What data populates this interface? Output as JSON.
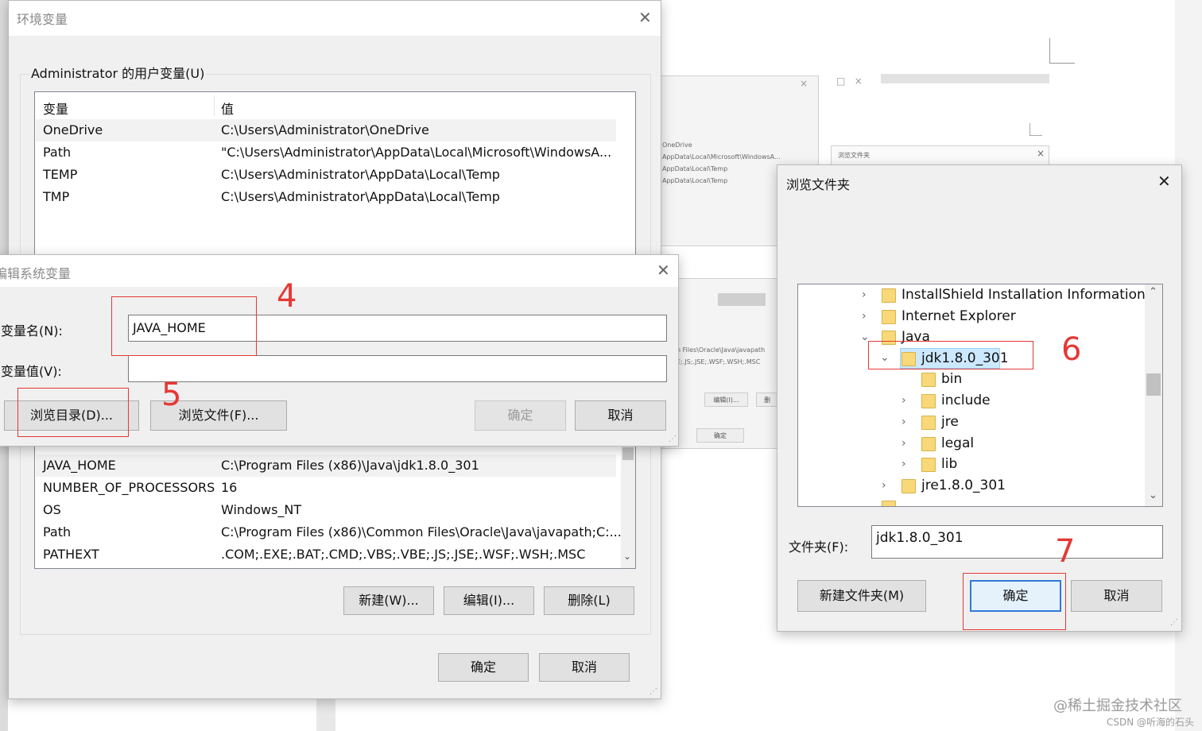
{
  "env_dialog": {
    "title": "环境变量",
    "user_section_label": "Administrator 的用户变量(U)",
    "columns": [
      "变量",
      "值"
    ],
    "user_vars": [
      {
        "name": "OneDrive",
        "value": "C:\\Users\\Administrator\\OneDrive"
      },
      {
        "name": "Path",
        "value": "\"C:\\Users\\Administrator\\AppData\\Local\\Microsoft\\WindowsA..."
      },
      {
        "name": "TEMP",
        "value": "C:\\Users\\Administrator\\AppData\\Local\\Temp"
      },
      {
        "name": "TMP",
        "value": "C:\\Users\\Administrator\\AppData\\Local\\Temp"
      }
    ],
    "system_vars": [
      {
        "name": "JAVA_HOME",
        "value": "C:\\Program Files (x86)\\Java\\jdk1.8.0_301"
      },
      {
        "name": "NUMBER_OF_PROCESSORS",
        "value": "16"
      },
      {
        "name": "OS",
        "value": "Windows_NT"
      },
      {
        "name": "Path",
        "value": "C:\\Program Files (x86)\\Common Files\\Oracle\\Java\\javapath;C:..."
      },
      {
        "name": "PATHEXT",
        "value": ".COM;.EXE;.BAT;.CMD;.VBS;.VBE;.JS;.JSE;.WSF;.WSH;.MSC"
      }
    ],
    "new_button": "新建(W)...",
    "edit_button": "编辑(I)...",
    "delete_button": "删除(L)",
    "ok_button": "确定",
    "cancel_button": "取消"
  },
  "edit_dialog": {
    "title": "编辑系统变量",
    "name_label": "变量名(N):",
    "name_value": "JAVA_HOME",
    "value_label": "变量值(V):",
    "value_value": "",
    "browse_dir_button": "浏览目录(D)...",
    "browse_file_button": "浏览文件(F)...",
    "ok_button": "确定",
    "cancel_button": "取消"
  },
  "browse_dialog": {
    "title": "浏览文件夹",
    "tree": [
      {
        "label": "InstallShield Installation Information"
      },
      {
        "label": "Internet Explorer"
      },
      {
        "label": "Java"
      },
      {
        "label": "jdk1.8.0_301"
      },
      {
        "label": "bin"
      },
      {
        "label": "include"
      },
      {
        "label": "jre"
      },
      {
        "label": "legal"
      },
      {
        "label": "lib"
      },
      {
        "label": "jre1.8.0_301"
      }
    ],
    "folder_label": "文件夹(F):",
    "folder_value": "jdk1.8.0_301",
    "new_folder_button": "新建文件夹(M)",
    "ok_button": "确定",
    "cancel_button": "取消"
  },
  "background_ghost": {
    "lines": [
      "OneDrive",
      "AppData\\Local\\Microsoft\\WindowsA...",
      "AppData\\Local\\Temp",
      "AppData\\Local\\Temp"
    ],
    "small_title": "浏览文件夹",
    "path_lines": [
      "n Files\\Oracle\\Java\\javapath",
      "E;.JS;.JSE;.WSF;.WSH;.MSC"
    ],
    "confirm": "确定",
    "edit": "编辑(I)...",
    "delete": "删"
  },
  "annotations": {
    "step4": "4",
    "step5": "5",
    "step6": "6",
    "step7": "7",
    "accent_color": "#e53935"
  },
  "watermark": {
    "line1": "@稀土掘金技术社区",
    "line2": "CSDN @听海的石头"
  }
}
